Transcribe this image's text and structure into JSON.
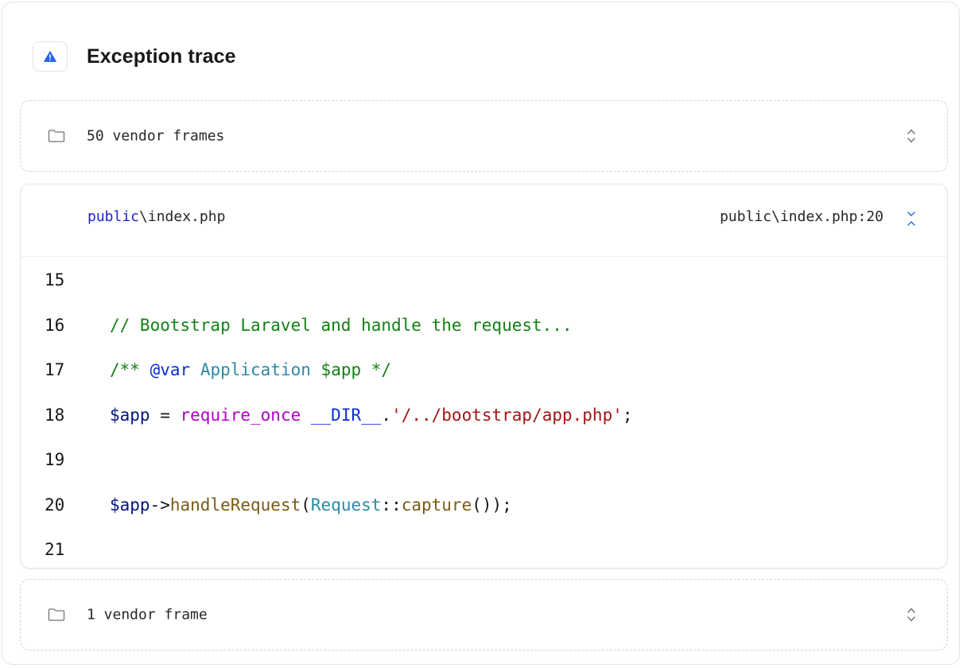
{
  "header": {
    "title": "Exception trace"
  },
  "vendor_groups": [
    {
      "label": "50 vendor frames"
    },
    {
      "label": "1 vendor frame"
    }
  ],
  "frame": {
    "file_namespace": "public",
    "file_rest": "\\index.php",
    "location": "public\\index.php:20",
    "lines": [
      {
        "number": "15",
        "tokens": []
      },
      {
        "number": "16",
        "tokens": [
          {
            "type": "comment",
            "text": "// Bootstrap Laravel and handle the request..."
          }
        ]
      },
      {
        "number": "17",
        "tokens": [
          {
            "type": "comment",
            "text": "/** "
          },
          {
            "type": "tag",
            "text": "@var"
          },
          {
            "type": "plain",
            "text": " "
          },
          {
            "type": "type",
            "text": "Application"
          },
          {
            "type": "plain",
            "text": " "
          },
          {
            "type": "comment",
            "text": "$app */"
          }
        ]
      },
      {
        "number": "18",
        "tokens": [
          {
            "type": "var",
            "text": "$app"
          },
          {
            "type": "plain",
            "text": " = "
          },
          {
            "type": "kw",
            "text": "require_once"
          },
          {
            "type": "plain",
            "text": " "
          },
          {
            "type": "const",
            "text": "__DIR__"
          },
          {
            "type": "plain",
            "text": "."
          },
          {
            "type": "str",
            "text": "'/../bootstrap/app.php'"
          },
          {
            "type": "plain",
            "text": ";"
          }
        ]
      },
      {
        "number": "19",
        "tokens": []
      },
      {
        "number": "20",
        "tokens": [
          {
            "type": "var",
            "text": "$app"
          },
          {
            "type": "plain",
            "text": "->"
          },
          {
            "type": "fn",
            "text": "handleRequest"
          },
          {
            "type": "plain",
            "text": "("
          },
          {
            "type": "cls",
            "text": "Request"
          },
          {
            "type": "plain",
            "text": "::"
          },
          {
            "type": "fn",
            "text": "capture"
          },
          {
            "type": "plain",
            "text": "());"
          }
        ]
      },
      {
        "number": "21",
        "tokens": []
      }
    ]
  },
  "icons": {
    "warning": "warning-triangle-icon",
    "folder": "folder-icon",
    "expand": "chevron-up-down-icon",
    "collapse": "chevron-collapse-icon"
  },
  "colors": {
    "warning_icon": "#2563eb",
    "accent_blue": "#2563eb",
    "border": "#e4e4e7",
    "dashed_border": "#d4d4d8"
  }
}
